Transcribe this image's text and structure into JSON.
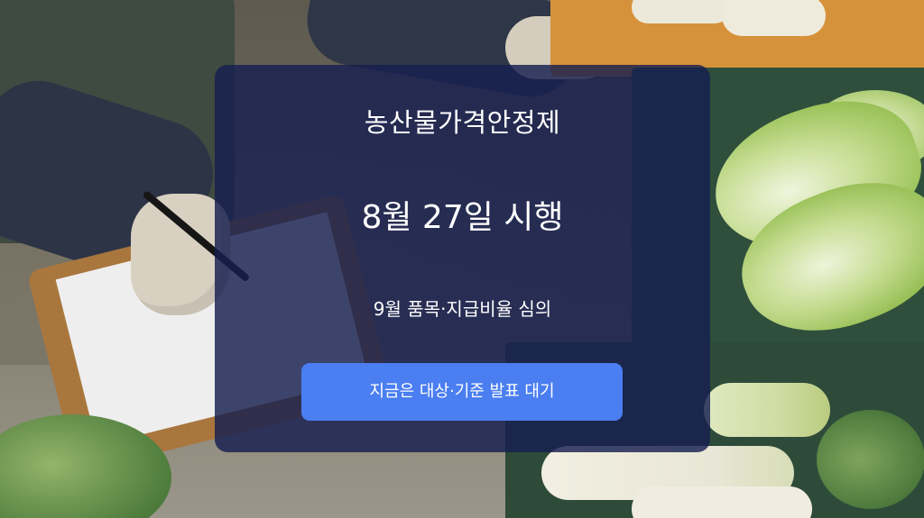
{
  "card": {
    "title": "농산물가격안정제",
    "date": "8월 27일 시행",
    "subtitle": "9월 품목·지급비율 심의",
    "button_label": "지금은 대상·기준 발표 대기"
  },
  "colors": {
    "card_background": "#161f4f",
    "button_background": "#4a7ef1",
    "text": "#ffffff"
  }
}
